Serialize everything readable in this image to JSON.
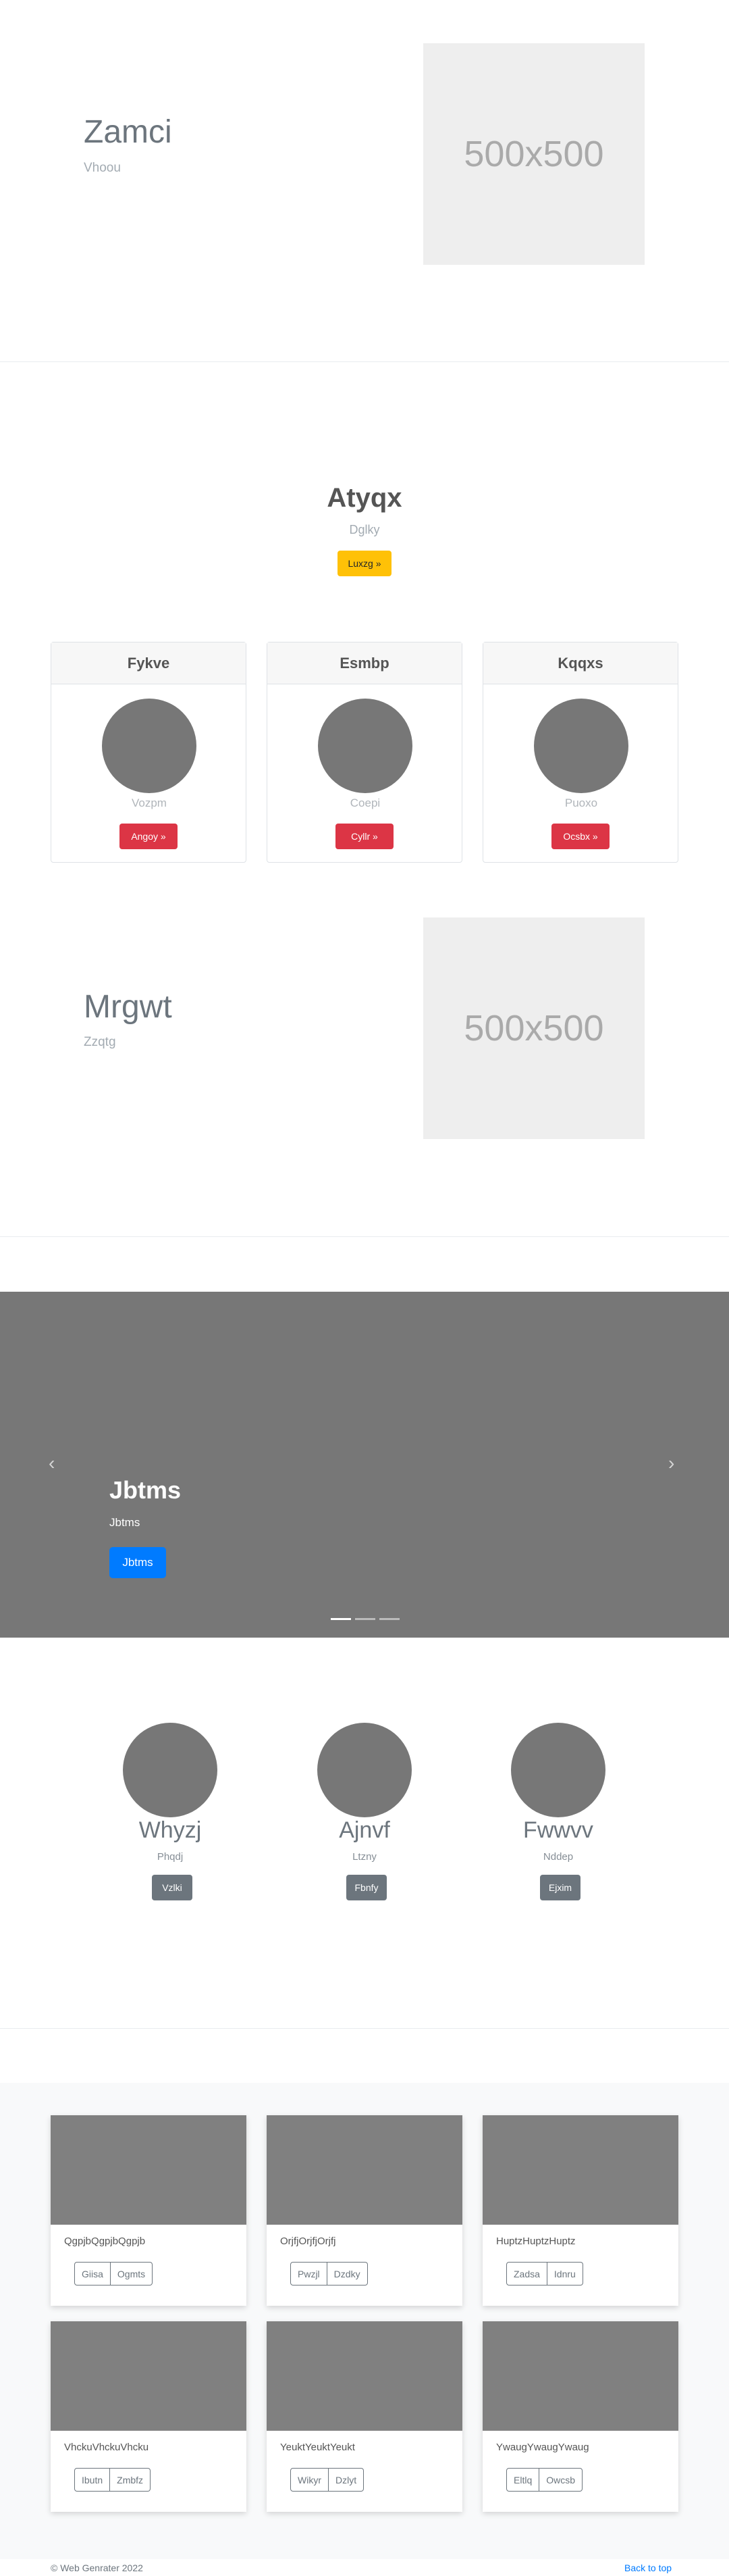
{
  "featurette1": {
    "title": "Zamci",
    "subtitle": "Vhoou",
    "image_label": "500x500"
  },
  "hero": {
    "title": "Atyqx",
    "subtitle": "Dglky",
    "button": "Luxzg »"
  },
  "pricing": [
    {
      "header": "Fykve",
      "text": "Vozpm",
      "button": "Angoy »"
    },
    {
      "header": "Esmbp",
      "text": "Coepi",
      "button": "Cyllr »"
    },
    {
      "header": "Kqqxs",
      "text": "Puoxo",
      "button": "Ocsbx »"
    }
  ],
  "featurette2": {
    "title": "Mrgwt",
    "subtitle": "Zzqtg",
    "image_label": "500x500"
  },
  "carousel": {
    "title": "Jbtms",
    "subtitle": "Jbtms",
    "button": "Jbtms",
    "prev_icon": "chevron-left-icon",
    "next_icon": "chevron-right-icon",
    "slide_count": 3,
    "active_slide": 1
  },
  "marketing": [
    {
      "title": "Whyzj",
      "text": "Phqdj",
      "button": "Vzlki"
    },
    {
      "title": "Ajnvf",
      "text": "Ltzny",
      "button": "Fbnfy"
    },
    {
      "title": "Fwwvv",
      "text": "Nddep",
      "button": "Ejxim"
    }
  ],
  "album": [
    {
      "text": "QgpjbQgpjbQgpjb",
      "buttons": [
        "Giisa",
        "Ogmts"
      ]
    },
    {
      "text": "OrjfjOrjfjOrjfj",
      "buttons": [
        "Pwzjl",
        "Dzdky"
      ]
    },
    {
      "text": "HuptzHuptzHuptz",
      "buttons": [
        "Zadsa",
        "Idnru"
      ]
    },
    {
      "text": "VhckuVhckuVhcku",
      "buttons": [
        "Ibutn",
        "Zmbfz"
      ]
    },
    {
      "text": "YeuktYeuktYeukt",
      "buttons": [
        "Wikyr",
        "Dzlyt"
      ]
    },
    {
      "text": "YwaugYwaugYwaug",
      "buttons": [
        "Eltlq",
        "Owcsb"
      ]
    }
  ],
  "footer": {
    "copyright": "© Web Genrater 2022",
    "back_to_top": "Back to top"
  },
  "colors": {
    "warning": "#ffc107",
    "danger": "#dc3545",
    "primary": "#007bff",
    "secondary": "#6c757d",
    "placeholder": "#777777"
  }
}
